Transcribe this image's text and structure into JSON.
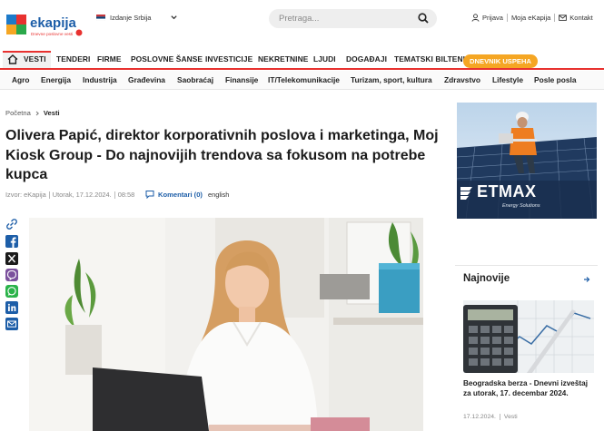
{
  "header": {
    "brand": "ekapija",
    "brand_tagline": "Dnevne poslovne vesti",
    "edition_label": "Izdanje Srbija",
    "search_placeholder": "Pretraga...",
    "links": {
      "login": "Prijava",
      "my": "Moja eKapija",
      "contact": "Kontakt"
    }
  },
  "nav_main": [
    "VESTI",
    "TENDERI",
    "FIRME",
    "POSLOVNE ŠANSE",
    "INVESTICIJE",
    "NEKRETNINE",
    "LJUDI",
    "DOGAĐAJI",
    "TEMATSKI BILTENI"
  ],
  "nav_highlight": "DNEVNIK USPEHA",
  "nav_sub": [
    "Agro",
    "Energija",
    "Industrija",
    "Građevina",
    "Saobraćaj",
    "Finansije",
    "IT/Telekomunikacije",
    "Turizam, sport, kultura",
    "Zdravstvo",
    "Lifestyle",
    "Posle posla"
  ],
  "breadcrumb": {
    "home": "Početna",
    "current": "Vesti"
  },
  "article": {
    "title": "Olivera Papić, direktor korporativnih poslova i marketinga, Moj Kiosk Group - Do najnovijih trendova sa fokusom na potrebe kupca",
    "source": "Izvor: eKapija",
    "day": "Utorak, 17.12.2024.",
    "time": "08:58",
    "comments": "Komentari (0)",
    "language": "english"
  },
  "share_icons": [
    "link-icon",
    "facebook-icon",
    "x-icon",
    "viber-icon",
    "whatsapp-icon",
    "linkedin-icon",
    "email-icon"
  ],
  "ad": {
    "brand": "ETMAX",
    "tagline": "Energy Solutions"
  },
  "newest": {
    "heading": "Najnovije",
    "item_title": "Beogradska berza - Dnevni izveštaj za utorak, 17. decembar 2024.",
    "item_date": "17.12.2024.",
    "item_category": "Vesti"
  },
  "colors": {
    "accent": "#e8312f",
    "pill": "#f5a623",
    "link": "#1d5ea8"
  }
}
